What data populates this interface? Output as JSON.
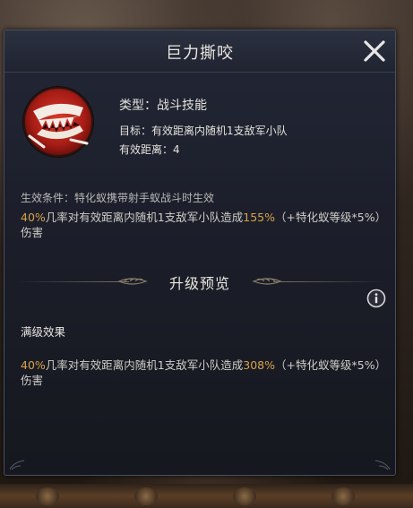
{
  "dialog": {
    "title": "巨力撕咬",
    "close_icon": "close-icon"
  },
  "skill": {
    "icon": "jaws-bite-icon",
    "type_label": "类型：",
    "type_value": "战斗技能",
    "target_label": "目标：",
    "target_value": "有效距离内随机1支敌军小队",
    "range_label": "有效距离：",
    "range_value": "4",
    "condition": "生效条件：特化蚁携带射手蚁战斗时生效",
    "description": {
      "chance": "40%",
      "text_a": "几率对有效距离内随机1支敌军小队造成",
      "damage": "155%",
      "text_b": "（+特化蚁等级*5%）伤害"
    }
  },
  "upgrade": {
    "title": "升级预览",
    "info_icon": "info-icon",
    "max_label": "满级效果",
    "description": {
      "chance": "40%",
      "text_a": "几率对有效距离内随机1支敌军小队造成",
      "damage": "308%",
      "text_b": "（+特化蚁等级*5%）伤害"
    }
  },
  "colors": {
    "highlight": "#d9a24a",
    "icon_red": "#b3221c"
  }
}
